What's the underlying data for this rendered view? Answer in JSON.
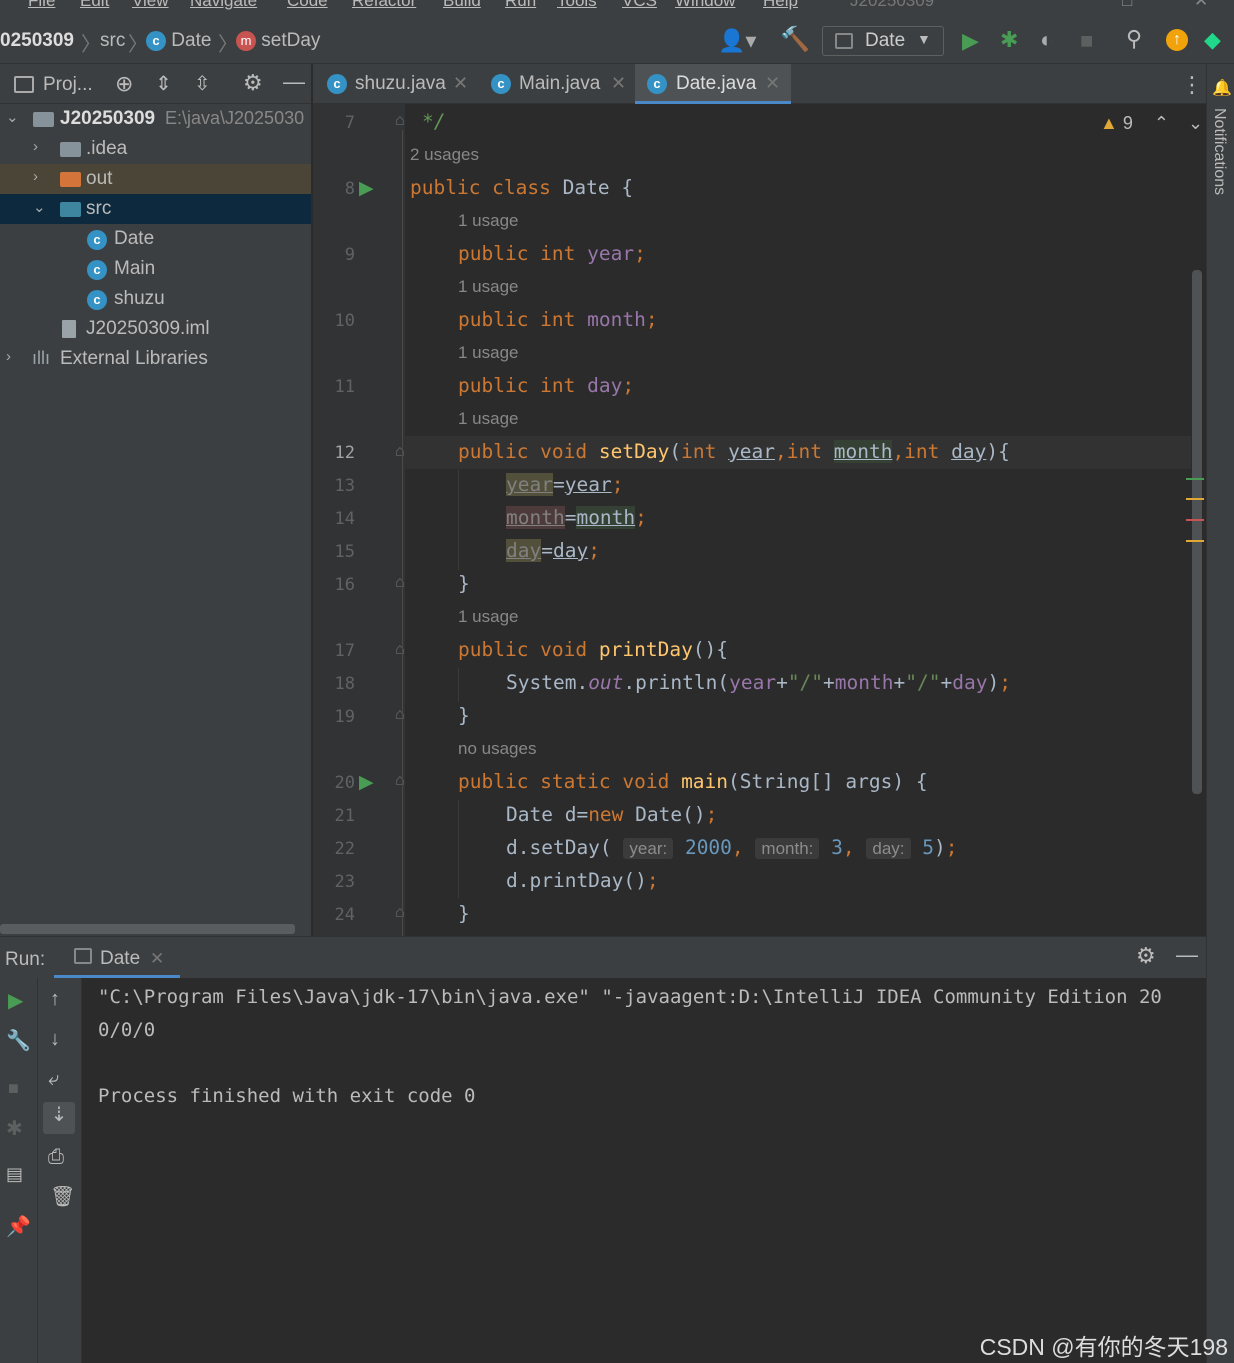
{
  "menu": [
    "File",
    "Edit",
    "View",
    "Navigate",
    "Code",
    "Refactor",
    "Build",
    "Run",
    "Tools",
    "VCS",
    "Window",
    "Help"
  ],
  "window_title": "J20250309",
  "breadcrumbs": {
    "project": "0250309",
    "folder": "src",
    "class": "Date",
    "method": "setDay"
  },
  "toolbar": {
    "run_config": "Date"
  },
  "project_panel": {
    "title": "Proj...",
    "tree": [
      {
        "label": "J20250309",
        "path": "E:\\java\\J2025030",
        "type": "module",
        "expanded": true
      },
      {
        "label": ".idea",
        "type": "folder",
        "expanded": false
      },
      {
        "label": "out",
        "type": "folder-excluded",
        "expanded": false
      },
      {
        "label": "src",
        "type": "source-folder",
        "expanded": true,
        "selected": true
      },
      {
        "label": "Date",
        "type": "class"
      },
      {
        "label": "Main",
        "type": "class"
      },
      {
        "label": "shuzu",
        "type": "class"
      },
      {
        "label": "J20250309.iml",
        "type": "file"
      },
      {
        "label": "External Libraries",
        "type": "libraries",
        "expanded": false
      }
    ]
  },
  "tabs": [
    {
      "label": "shuzu.java",
      "active": false
    },
    {
      "label": "Main.java",
      "active": false
    },
    {
      "label": "Date.java",
      "active": true
    }
  ],
  "editor": {
    "warnings": "9",
    "usages": {
      "u1": "2 usages",
      "u2": "1 usage",
      "u3": "1 usage",
      "u4": "1 usage",
      "u5": "1 usage",
      "u6": "1 usage",
      "u7": "no usages"
    },
    "lines": {
      "l7": "*/",
      "l8": "public class Date {",
      "l9": "public int year;",
      "l10": "public int month;",
      "l11": "public int day;",
      "l12": "public void setDay(int year,int month,int day){",
      "l13": "year=year;",
      "l14": "month=month;",
      "l15": "day=day;",
      "l16": "}",
      "l17": "public void printDay(){",
      "l18": "System.out.println(year+\"/\"+month+\"/\"+day);",
      "l19": "}",
      "l20": "public static void main(String[] args) {",
      "l21": "Date d=new Date();",
      "l22": "d.setDay( year: 2000, month: 3, day: 5);",
      "l23": "d.printDay();",
      "l24": "}"
    },
    "line_numbers": [
      "7",
      "8",
      "9",
      "10",
      "11",
      "12",
      "13",
      "14",
      "15",
      "16",
      "17",
      "18",
      "19",
      "20",
      "21",
      "22",
      "23",
      "24"
    ],
    "hints": {
      "year": "year:",
      "month": "month:",
      "day": "day:"
    }
  },
  "run_panel": {
    "label": "Run:",
    "tab": "Date",
    "output": [
      "\"C:\\Program Files\\Java\\jdk-17\\bin\\java.exe\" \"-javaagent:D:\\IntelliJ IDEA Community Edition 20",
      "0/0/0",
      "",
      "Process finished with exit code 0"
    ]
  },
  "side_label": "Notifications",
  "watermark": "CSDN @有你的冬天198",
  "colors": {
    "keyword": "#cc7832",
    "field": "#9876aa",
    "method": "#ffc66d",
    "number": "#6897bb",
    "string": "#6a8759",
    "background": "#2b2b2b",
    "panel": "#3c3f41",
    "run_green": "#499c54",
    "selection": "#0d293e"
  }
}
